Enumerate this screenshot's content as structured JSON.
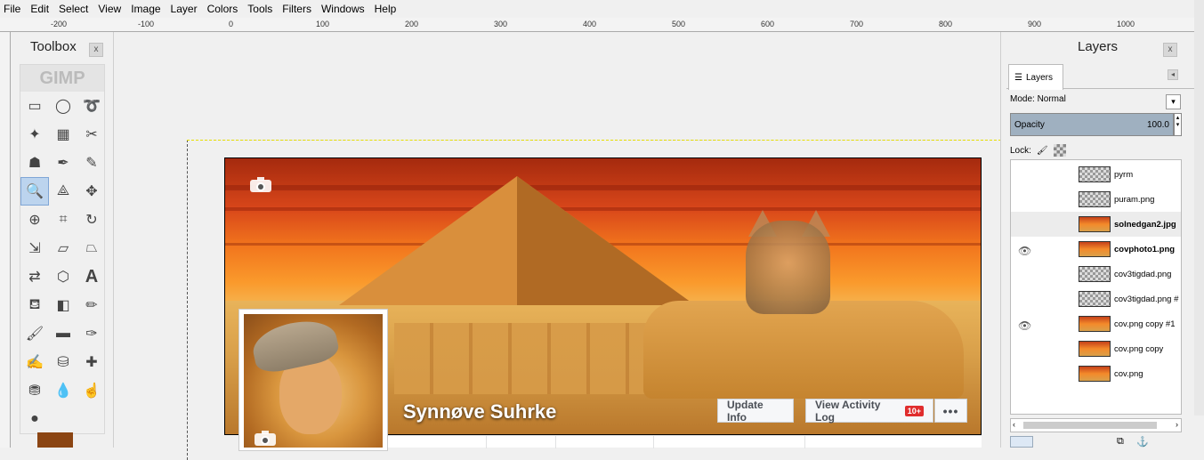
{
  "menu": [
    "File",
    "Edit",
    "Select",
    "View",
    "Image",
    "Layer",
    "Colors",
    "Tools",
    "Filters",
    "Windows",
    "Help"
  ],
  "ruler": {
    "ticks": [
      "-200",
      "-100",
      "0",
      "100",
      "200",
      "300",
      "400",
      "500",
      "600",
      "700",
      "800",
      "900",
      "1000"
    ]
  },
  "toolbox": {
    "title": "Toolbox",
    "close": "x",
    "wilber": "GIMP"
  },
  "canvas": {
    "profile_name": "Synnøve Suhrke",
    "update_info": "Update Info",
    "activity_log": "View Activity Log",
    "activity_badge": "10+",
    "more": "•••"
  },
  "layers": {
    "title": "Layers",
    "close": "x",
    "tab_label": "Layers",
    "mode_label": "Mode: Normal",
    "opacity_label": "Opacity",
    "opacity_value": "100.0",
    "lock_label": "Lock:",
    "items": [
      {
        "name": "pyrm",
        "visible": false,
        "bold": false
      },
      {
        "name": "puram.png",
        "visible": false,
        "bold": false
      },
      {
        "name": "solnedgan2.jpg",
        "visible": false,
        "bold": true
      },
      {
        "name": "covphoto1.png",
        "visible": true,
        "bold": true
      },
      {
        "name": "cov3tigdad.png",
        "visible": false,
        "bold": false
      },
      {
        "name": "cov3tigdad.png #",
        "visible": false,
        "bold": false
      },
      {
        "name": "cov.png copy #1",
        "visible": true,
        "bold": false
      },
      {
        "name": "cov.png copy",
        "visible": false,
        "bold": false
      },
      {
        "name": "cov.png",
        "visible": false,
        "bold": false
      }
    ]
  },
  "colors": {
    "foreground": "#8b4513",
    "selection": "#7fa6d6"
  }
}
